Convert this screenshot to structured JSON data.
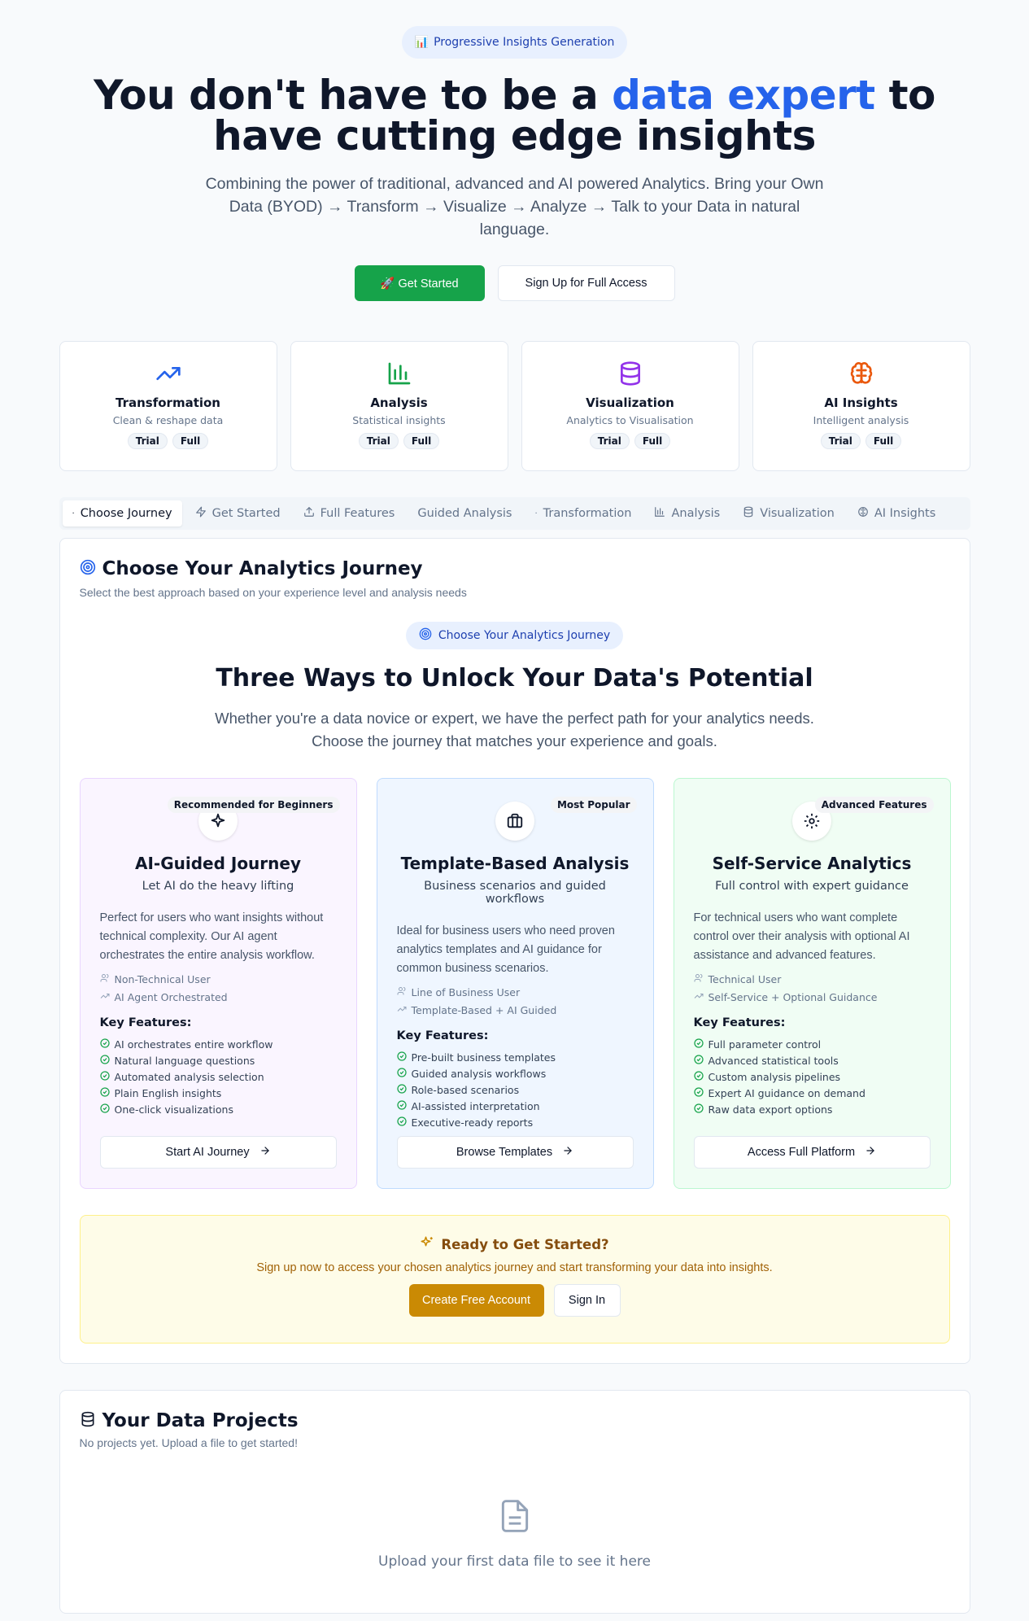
{
  "hero": {
    "badge_icon": "📊",
    "badge": "Progressive Insights Generation",
    "title_pre": "You don't have to be a",
    "title_accent": "data expert",
    "title_post": "to have cutting edge insights",
    "accent_color": "#2563eb",
    "subtitle": "Combining the power of traditional, advanced and AI powered Analytics. Bring your Own Data (BYOD) → Transform → Visualize → Analyze → Talk to your Data in natural language.",
    "get_started": "🚀 Get Started",
    "signup": "Sign Up for Full Access"
  },
  "features": [
    {
      "title": "Transformation",
      "subtitle": "Clean & reshape data",
      "icon": "trending-up-icon",
      "color": "#2563eb",
      "trial": "Trial",
      "full": "Full"
    },
    {
      "title": "Analysis",
      "subtitle": "Statistical insights",
      "icon": "bar-chart-icon",
      "color": "#16a34a",
      "trial": "Trial",
      "full": "Full"
    },
    {
      "title": "Visualization",
      "subtitle": "Analytics to Visualisation",
      "icon": "database-icon",
      "color": "#9333ea",
      "trial": "Trial",
      "full": "Full"
    },
    {
      "title": "AI Insights",
      "subtitle": "Intelligent analysis",
      "icon": "brain-icon",
      "color": "#ea580c",
      "trial": "Trial",
      "full": "Full"
    }
  ],
  "tabs": [
    {
      "label": "Choose Journey",
      "icon": "dot-icon"
    },
    {
      "label": "Get Started",
      "icon": "zap-icon"
    },
    {
      "label": "Full Features",
      "icon": "upload-icon"
    },
    {
      "label": "Guided Analysis",
      "icon": ""
    },
    {
      "label": "Transformation",
      "icon": "dot-icon"
    },
    {
      "label": "Analysis",
      "icon": "bar-chart-icon"
    },
    {
      "label": "Visualization",
      "icon": "database-icon"
    },
    {
      "label": "AI Insights",
      "icon": "brain-icon"
    }
  ],
  "journey": {
    "title": "Choose Your Analytics Journey",
    "description": "Select the best approach based on your experience level and analysis needs",
    "chip": "Choose Your Analytics Journey",
    "heading": "Three Ways to Unlock Your Data's Potential",
    "subheading": "Whether you're a data novice or expert, we have the perfect path for your analytics needs. Choose the journey that matches your experience and goals.",
    "key_features_label": "Key Features:",
    "cards": [
      {
        "badge": "Recommended for Beginners",
        "icon": "sparkle-icon",
        "title": "AI-Guided Journey",
        "tagline": "Let AI do the heavy lifting",
        "description": "Perfect for users who want insights without technical complexity. Our AI agent orchestrates the entire analysis workflow.",
        "meta1": "Non-Technical User",
        "meta2": "AI Agent Orchestrated",
        "features": [
          "AI orchestrates entire workflow",
          "Natural language questions",
          "Automated analysis selection",
          "Plain English insights",
          "One-click visualizations"
        ],
        "button": "Start AI Journey"
      },
      {
        "badge": "Most Popular",
        "icon": "briefcase-icon",
        "title": "Template-Based Analysis",
        "tagline": "Business scenarios and guided workflows",
        "description": "Ideal for business users who need proven analytics templates and AI guidance for common business scenarios.",
        "meta1": "Line of Business User",
        "meta2": "Template-Based + AI Guided",
        "features": [
          "Pre-built business templates",
          "Guided analysis workflows",
          "Role-based scenarios",
          "AI-assisted interpretation",
          "Executive-ready reports"
        ],
        "button": "Browse Templates"
      },
      {
        "badge": "Advanced Features",
        "icon": "gear-icon",
        "title": "Self-Service Analytics",
        "tagline": "Full control with expert guidance",
        "description": "For technical users who want complete control over their analysis with optional AI assistance and advanced features.",
        "meta1": "Technical User",
        "meta2": "Self-Service + Optional Guidance",
        "features": [
          "Full parameter control",
          "Advanced statistical tools",
          "Custom analysis pipelines",
          "Expert AI guidance on demand",
          "Raw data export options"
        ],
        "button": "Access Full Platform"
      }
    ]
  },
  "ready": {
    "title": "Ready to Get Started?",
    "subtitle": "Sign up now to access your chosen analytics journey and start transforming your data into insights.",
    "create": "Create Free Account",
    "signin": "Sign In"
  },
  "projects": {
    "title": "Your Data Projects",
    "description": "No projects yet. Upload a file to get started!",
    "empty": "Upload your first data file to see it here"
  }
}
